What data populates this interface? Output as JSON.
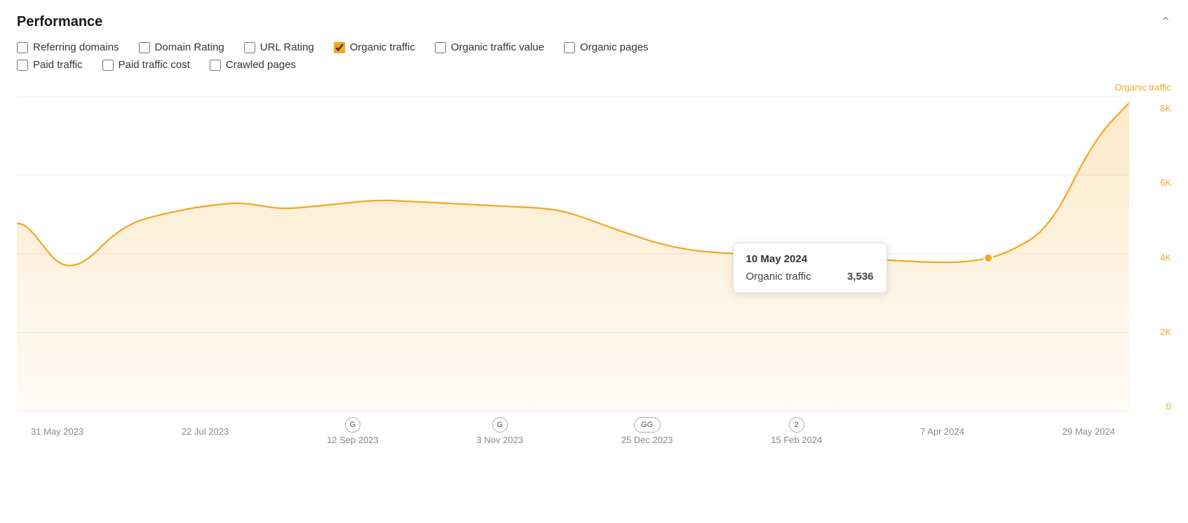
{
  "header": {
    "title": "Performance",
    "collapse_label": "collapse"
  },
  "checkboxes": {
    "row1": [
      {
        "id": "referring-domains",
        "label": "Referring domains",
        "checked": false
      },
      {
        "id": "domain-rating",
        "label": "Domain Rating",
        "checked": false
      },
      {
        "id": "url-rating",
        "label": "URL Rating",
        "checked": false
      },
      {
        "id": "organic-traffic",
        "label": "Organic traffic",
        "checked": true
      },
      {
        "id": "organic-traffic-value",
        "label": "Organic traffic value",
        "checked": false
      },
      {
        "id": "organic-pages",
        "label": "Organic pages",
        "checked": false
      }
    ],
    "row2": [
      {
        "id": "paid-traffic",
        "label": "Paid traffic",
        "checked": false
      },
      {
        "id": "paid-traffic-cost",
        "label": "Paid traffic cost",
        "checked": false
      },
      {
        "id": "crawled-pages",
        "label": "Crawled pages",
        "checked": false
      }
    ]
  },
  "chart": {
    "y_axis_label": "Organic traffic",
    "y_ticks": [
      "8K",
      "6K",
      "4K",
      "2K",
      "0"
    ],
    "x_ticks": [
      {
        "label": "31 May 2023",
        "marker": null
      },
      {
        "label": "22 Jul 2023",
        "marker": null
      },
      {
        "label": "12 Sep 2023",
        "marker": "G"
      },
      {
        "label": "3 Nov 2023",
        "marker": "G"
      },
      {
        "label": "25 Dec 2023",
        "marker": "GG"
      },
      {
        "label": "15 Feb 2024",
        "marker": "2"
      },
      {
        "label": "7 Apr 2024",
        "marker": null
      },
      {
        "label": "29 May 2024",
        "marker": null
      }
    ],
    "tooltip": {
      "date": "10 May 2024",
      "metric": "Organic traffic",
      "value": "3,536"
    },
    "accent_color": "#f5a623",
    "fill_color": "rgba(245, 166, 35, 0.12)"
  }
}
